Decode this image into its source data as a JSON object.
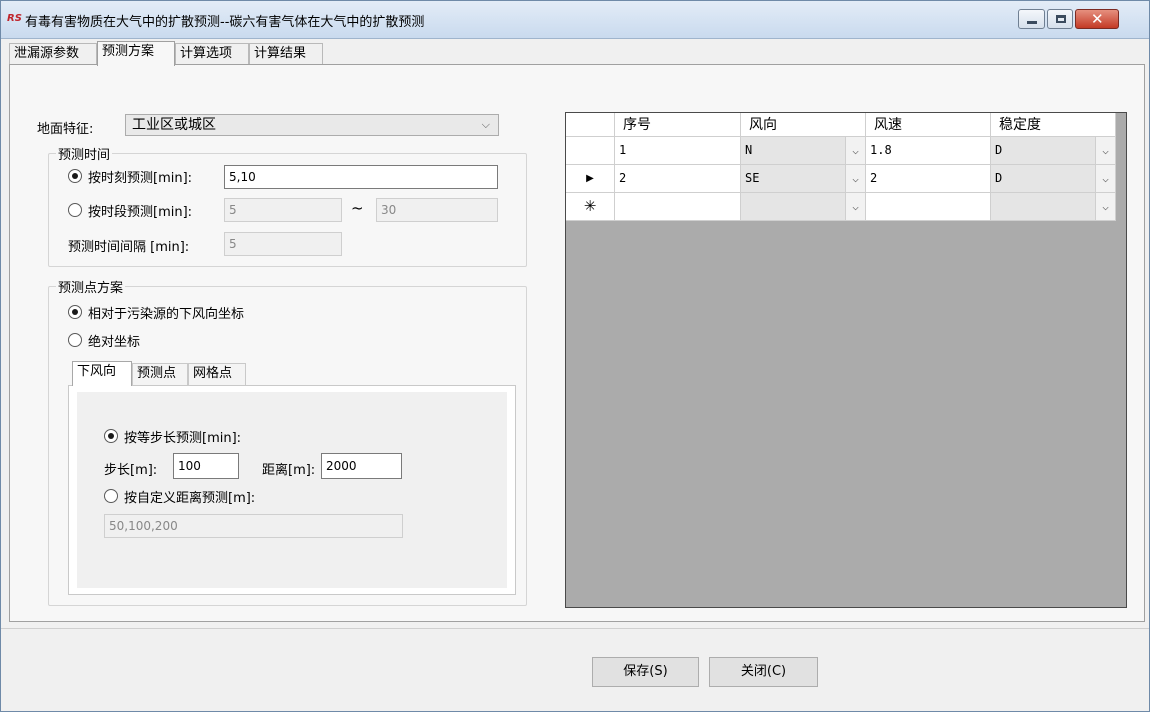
{
  "window": {
    "title": "有毒有害物质在大气中的扩散预测--碳六有害气体在大气中的扩散预测",
    "app_icon": "RS"
  },
  "tabs": [
    "泄漏源参数",
    "预测方案",
    "计算选项",
    "计算结果"
  ],
  "active_tab": "预测方案",
  "ground": {
    "label": "地面特征:",
    "value": "工业区或城区"
  },
  "forecast_time": {
    "title": "预测时间",
    "by_moment_label": "按时刻预测[min]:",
    "by_moment_value": "5,10",
    "by_moment_selected": true,
    "by_period_label": "按时段预测[min]:",
    "period_from": "5",
    "period_tilde": "~",
    "period_to": "30",
    "interval_label": "预测时间间隔 [min]:",
    "interval_value": "5"
  },
  "point_plan": {
    "title": "预测点方案",
    "relative_label": "相对于污染源的下风向坐标",
    "relative_selected": true,
    "absolute_label": "绝对坐标"
  },
  "subtabs": [
    "下风向",
    "预测点",
    "网格点"
  ],
  "downwind": {
    "equal_step_label": "按等步长预测[min]:",
    "equal_step_selected": true,
    "step_label": "步长[m]:",
    "step_value": "100",
    "distance_label": "距离[m]:",
    "distance_value": "2000",
    "custom_label": "按自定义距离预测[m]:",
    "custom_value": "50,100,200"
  },
  "grid": {
    "headers": [
      "序号",
      "风向",
      "风速",
      "稳定度"
    ],
    "rows": [
      {
        "marker": "",
        "no": "1",
        "dir": "N",
        "speed": "1.8",
        "stab": "D"
      },
      {
        "marker": "▶",
        "no": "2",
        "dir": "SE",
        "speed": "2",
        "stab": "D"
      },
      {
        "marker": "✳",
        "no": "",
        "dir": "",
        "speed": "",
        "stab": ""
      }
    ]
  },
  "buttons": {
    "save": "保存(S)",
    "close": "关闭(C)"
  }
}
